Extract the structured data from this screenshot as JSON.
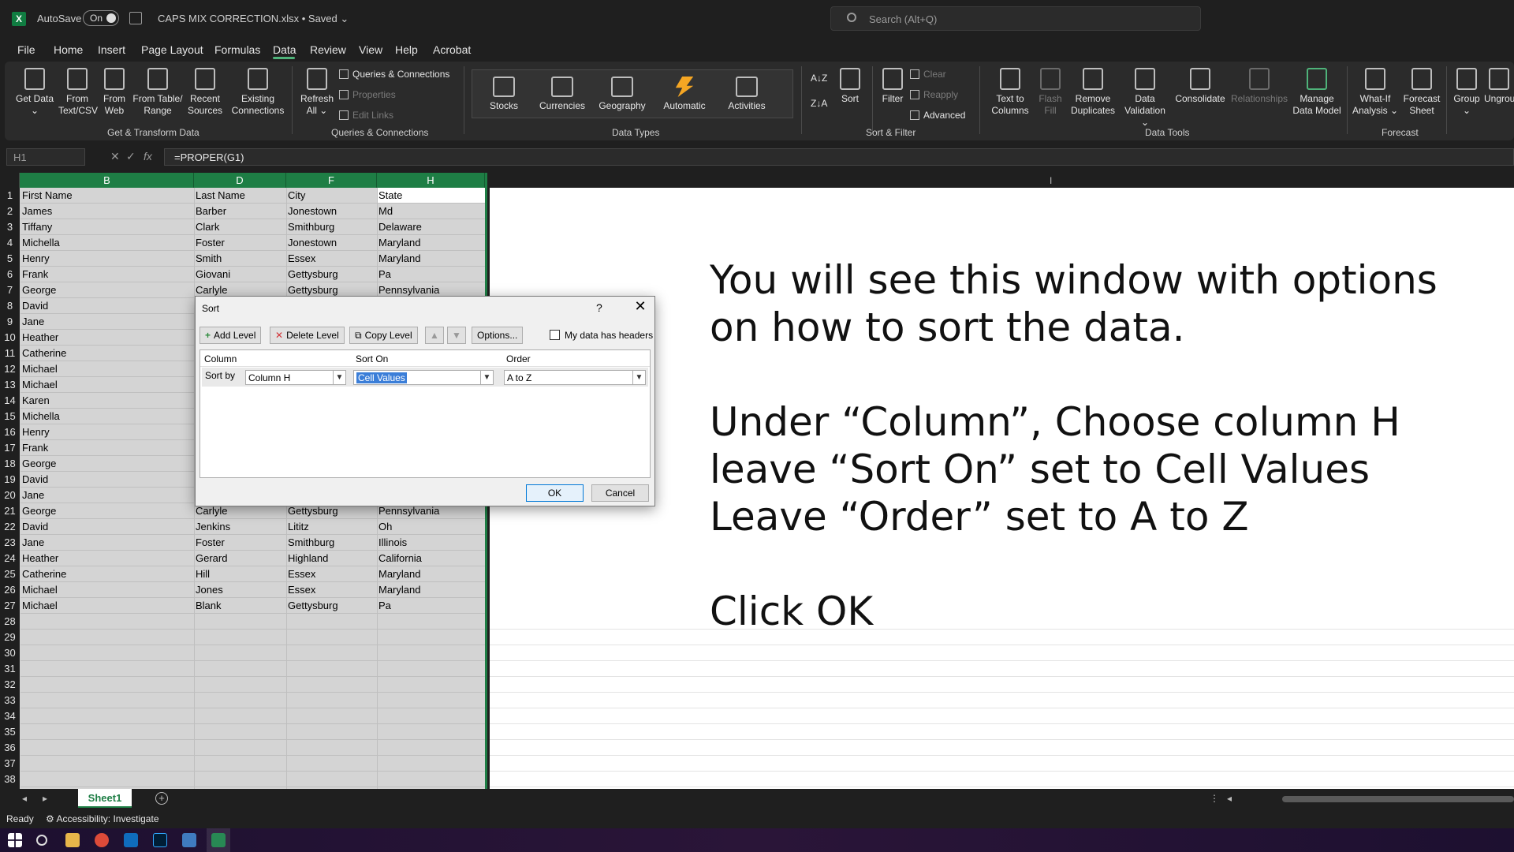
{
  "titlebar": {
    "app_logo": "X",
    "autosave_label": "AutoSave",
    "autosave_state": "On",
    "document_title": "CAPS MIX CORRECTION.xlsx • Saved ⌄",
    "search_placeholder": "Search (Alt+Q)"
  },
  "menu": {
    "tabs": [
      "File",
      "Home",
      "Insert",
      "Page Layout",
      "Formulas",
      "Data",
      "Review",
      "View",
      "Help",
      "Acrobat"
    ],
    "active_tab": "Data"
  },
  "ribbon": {
    "get_transform": {
      "get_data": "Get Data ⌄",
      "from_text_csv": "From Text/CSV",
      "from_web": "From Web",
      "from_table_range": "From Table/ Range",
      "recent_sources": "Recent Sources",
      "existing_connections": "Existing Connections",
      "group_label": "Get & Transform Data"
    },
    "queries": {
      "refresh_all": "Refresh All ⌄",
      "queries_connections": "Queries & Connections",
      "properties": "Properties",
      "edit_links": "Edit Links",
      "group_label": "Queries & Connections"
    },
    "data_types": {
      "items": [
        "Stocks",
        "Currencies",
        "Geography",
        "Automatic",
        "Activities"
      ],
      "group_label": "Data Types"
    },
    "sort_filter": {
      "sort_az": "A↓Z",
      "sort_za": "Z↓A",
      "sort": "Sort",
      "filter": "Filter",
      "clear": "Clear",
      "reapply": "Reapply",
      "advanced": "Advanced",
      "group_label": "Sort & Filter"
    },
    "data_tools": {
      "text_to_columns": "Text to Columns",
      "flash_fill": "Flash Fill",
      "remove_duplicates": "Remove Duplicates",
      "data_validation": "Data Validation ⌄",
      "consolidate": "Consolidate",
      "relationships": "Relationships",
      "manage_data_model": "Manage Data Model",
      "group_label": "Data Tools"
    },
    "forecast": {
      "what_if": "What-If Analysis ⌄",
      "forecast_sheet": "Forecast Sheet",
      "group_label": "Forecast"
    },
    "outline": {
      "group": "Group ⌄",
      "ungroup": "Ungroup ⌄"
    }
  },
  "formula_bar": {
    "name_box": "H1",
    "fx": "fx",
    "formula": "=PROPER(G1)"
  },
  "grid": {
    "columns": [
      "B",
      "D",
      "F",
      "H"
    ],
    "row_numbers": [
      "1",
      "2",
      "3",
      "4",
      "5",
      "6",
      "7",
      "8",
      "9",
      "10",
      "11",
      "12",
      "13",
      "14",
      "15",
      "16",
      "17",
      "18",
      "19",
      "20",
      "21",
      "22",
      "23",
      "24",
      "25",
      "26",
      "27",
      "28",
      "29",
      "30",
      "31",
      "32",
      "33",
      "34",
      "35",
      "36",
      "37",
      "38"
    ],
    "rows": [
      [
        "First Name",
        "Last Name",
        "City",
        "State"
      ],
      [
        "James",
        "Barber",
        "Jonestown",
        "Md"
      ],
      [
        "Tiffany",
        "Clark",
        "Smithburg",
        "Delaware"
      ],
      [
        "Michella",
        "Foster",
        "Jonestown",
        "Maryland"
      ],
      [
        "Henry",
        "Smith",
        "Essex",
        "Maryland"
      ],
      [
        "Frank",
        "Giovani",
        "Gettysburg",
        "Pa"
      ],
      [
        "George",
        "Carlyle",
        "Gettysburg",
        "Pennsylvania"
      ],
      [
        "David",
        "",
        "",
        ""
      ],
      [
        "Jane",
        "",
        "",
        ""
      ],
      [
        "Heather",
        "",
        "",
        ""
      ],
      [
        "Catherine",
        "",
        "",
        ""
      ],
      [
        "Michael",
        "",
        "",
        ""
      ],
      [
        "Michael",
        "",
        "",
        ""
      ],
      [
        "Karen",
        "",
        "",
        ""
      ],
      [
        "Michella",
        "",
        "",
        ""
      ],
      [
        "Henry",
        "",
        "",
        ""
      ],
      [
        "Frank",
        "",
        "",
        ""
      ],
      [
        "George",
        "",
        "",
        ""
      ],
      [
        "David",
        "",
        "",
        ""
      ],
      [
        "Jane",
        "",
        "",
        ""
      ],
      [
        "George",
        "Carlyle",
        "Gettysburg",
        "Pennsylvania"
      ],
      [
        "David",
        "Jenkins",
        "Lititz",
        "Oh"
      ],
      [
        "Jane",
        "Foster",
        "Smithburg",
        "Illinois"
      ],
      [
        "Heather",
        "Gerard",
        "Highland",
        "California"
      ],
      [
        "Catherine",
        "Hill",
        "Essex",
        "Maryland"
      ],
      [
        "Michael",
        "Jones",
        "Essex",
        "Maryland"
      ],
      [
        "Michael",
        "Blank",
        "Gettysburg",
        "Pa"
      ]
    ]
  },
  "dialog": {
    "title": "Sort",
    "help": "?",
    "close": "✕",
    "add_level": "Add Level",
    "delete_level": "Delete Level",
    "copy_level": "Copy Level",
    "move_up": "▲",
    "move_down": "▼",
    "options": "Options...",
    "headers_checkbox": "My data has headers",
    "col_header": "Column",
    "sort_on_header": "Sort On",
    "order_header": "Order",
    "sort_by_label": "Sort by",
    "column_value": "Column H",
    "sort_on_value": "Cell Values",
    "order_value": "A to Z",
    "ok": "OK",
    "cancel": "Cancel"
  },
  "instructions": {
    "line1": "You will see this window with options on how to sort the data.",
    "line2": "Under “Column”, Choose column H",
    "line3": "leave “Sort On” set to Cell Values",
    "line4": "Leave “Order” set to A to Z",
    "line5": "Click OK"
  },
  "sheet_tabs": {
    "active": "Sheet1",
    "add": "+"
  },
  "status": {
    "ready": "Ready",
    "accessibility": "Accessibility: Investigate"
  }
}
